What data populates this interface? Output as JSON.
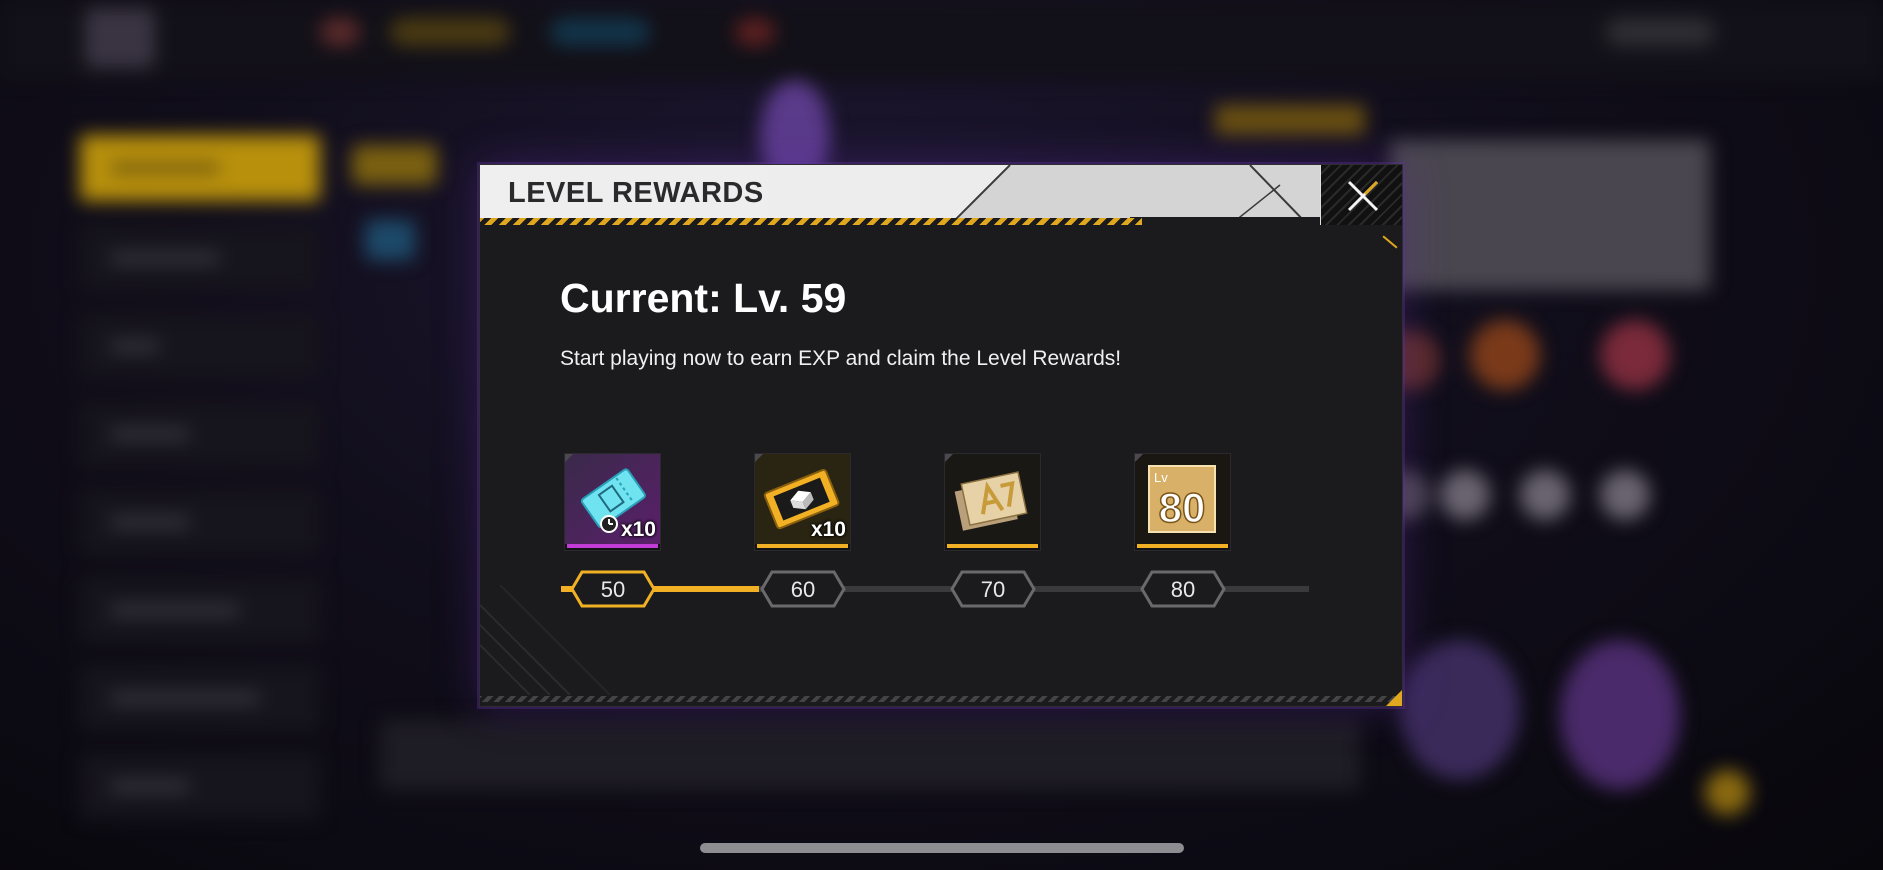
{
  "modal": {
    "title": "LEVEL REWARDS",
    "current_level_text": "Current: Lv. 59",
    "hint": "Start playing now to earn EXP and claim the Level Rewards!",
    "progress_fraction": 0.265
  },
  "rewards": [
    {
      "level": "50",
      "quantity": "x10",
      "icon": "ticket-icon",
      "rarity_color": "#c23bd6",
      "reached": true
    },
    {
      "level": "60",
      "quantity": "x10",
      "icon": "crate-voucher-icon",
      "rarity_color": "#f2b124",
      "reached": false
    },
    {
      "level": "70",
      "quantity": "",
      "icon": "card-pack-icon",
      "rarity_color": "#f2b124",
      "reached": false
    },
    {
      "level": "80",
      "quantity": "",
      "icon": "lv80-badge-icon",
      "badge_prefix": "Lv",
      "badge_number": "80",
      "rarity_color": "#f2b124",
      "reached": false
    }
  ],
  "colors": {
    "accent": "#f2b124",
    "panel": "#1b1b1d",
    "header": "#ececec"
  }
}
